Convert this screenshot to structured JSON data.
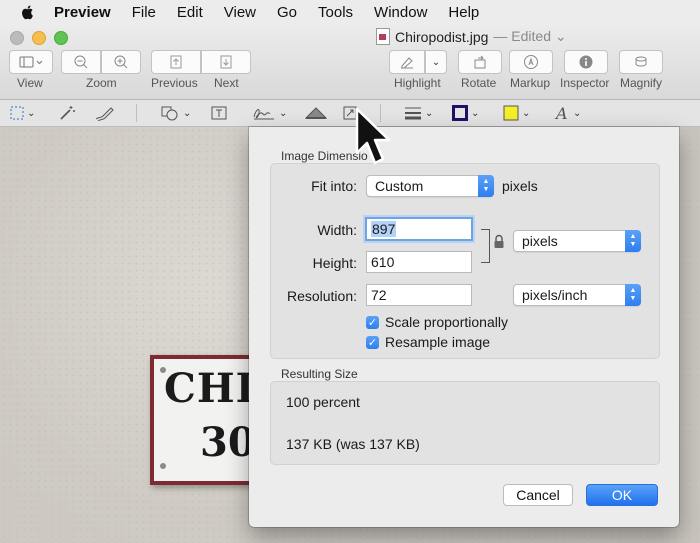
{
  "menubar": {
    "app": "Preview",
    "items": [
      "File",
      "Edit",
      "View",
      "Go",
      "Tools",
      "Window",
      "Help"
    ]
  },
  "window": {
    "title": "Chiropodist.jpg",
    "edited": "— Edited ⌄"
  },
  "toolbar": {
    "view_label": "View",
    "zoom_label": "Zoom",
    "previous_label": "Previous",
    "next_label": "Next",
    "highlight_label": "Highlight",
    "rotate_label": "Rotate",
    "markup_label": "Markup",
    "inspector_label": "Inspector",
    "magnify_label": "Magnify"
  },
  "markup_tools": [
    "selection-icon",
    "instant-alpha-icon",
    "sketch-icon",
    "shapes-icon",
    "text-icon",
    "sign-icon",
    "adjust-color-icon",
    "adjust-size-icon",
    "shape-style-icon",
    "border-color-icon",
    "fill-color-icon",
    "text-style-icon"
  ],
  "colors": {
    "border_swatch": "#1e1466",
    "fill_swatch": "#f5ef2a",
    "accent": "#2e7ef1"
  },
  "image": {
    "sign_line1": "CHI",
    "sign_line2": "30"
  },
  "dialog": {
    "image_dimensions_label": "Image Dimensio",
    "fit_into_label": "Fit into:",
    "fit_into_value": "Custom",
    "fit_into_unit": "pixels",
    "width_label": "Width:",
    "width_value": "897",
    "height_label": "Height:",
    "height_value": "610",
    "size_unit": "pixels",
    "resolution_label": "Resolution:",
    "resolution_value": "72",
    "resolution_unit": "pixels/inch",
    "scale_label": "Scale proportionally",
    "scale_checked": true,
    "resample_label": "Resample image",
    "resample_checked": true,
    "resulting_size_label": "Resulting Size",
    "percent_text": "100 percent",
    "size_text": "137 KB (was 137 KB)",
    "cancel_label": "Cancel",
    "ok_label": "OK"
  }
}
